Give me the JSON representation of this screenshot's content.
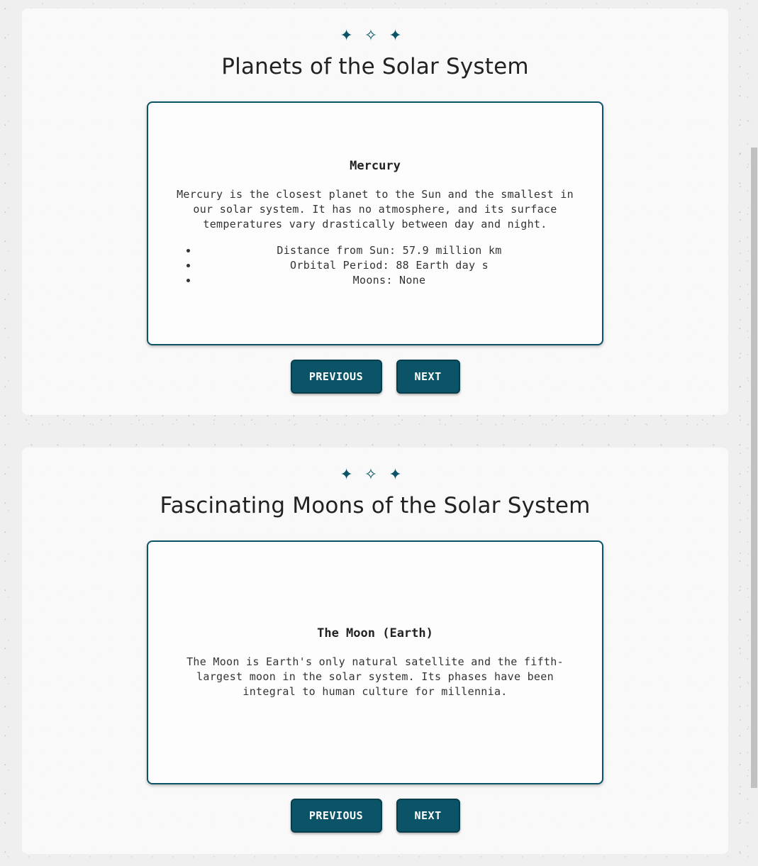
{
  "planets": {
    "stars": [
      "✦",
      "✧",
      "✦"
    ],
    "title": "Planets of the Solar System",
    "card": {
      "name": "Mercury",
      "description": "Mercury is the closest planet to the Sun and the smallest in our solar system. It has no atmosphere, and its surface temperatures vary drastically between day and night.",
      "facts": [
        "Distance from Sun: 57.9 million km",
        "Orbital Period: 88 Earth day s",
        "Moons: None"
      ]
    },
    "prev_label": "PREVIOUS",
    "next_label": "NEXT"
  },
  "moons": {
    "stars": [
      "✦",
      "✧",
      "✦"
    ],
    "title": "Fascinating Moons of the Solar System",
    "card": {
      "name": "The Moon (Earth)",
      "description": "The Moon is Earth's only natural satellite and the fifth-largest moon in the solar system. Its phases have been integral to human culture for millennia."
    },
    "prev_label": "PREVIOUS",
    "next_label": "NEXT"
  },
  "colors": {
    "accent": "#0b5468",
    "background": "#efefef",
    "card": "#fdfdfd"
  }
}
